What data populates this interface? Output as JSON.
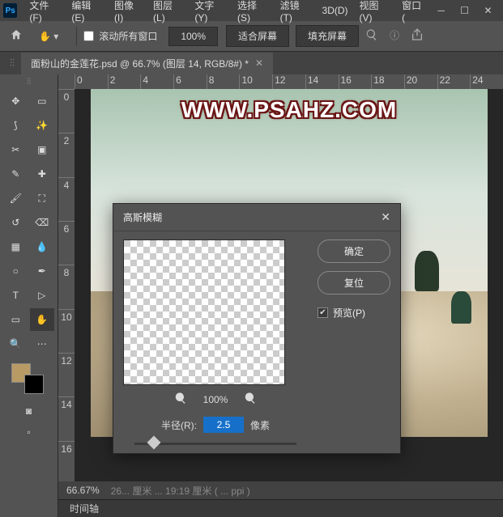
{
  "menu": {
    "file": "文件(F)",
    "edit": "编辑(E)",
    "image": "图像(I)",
    "layer": "图层(L)",
    "type": "文字(Y)",
    "select": "选择(S)",
    "filter": "滤镜(T)",
    "threeD": "3D(D)",
    "view": "视图(V)",
    "window": "窗口("
  },
  "options": {
    "scroll_all": "滚动所有窗口",
    "zoom": "100%",
    "fit_screen": "适合屏幕",
    "fill_screen": "填充屏幕"
  },
  "tab": {
    "title": "面粉山的金莲花.psd @ 66.7% (图层 14, RGB/8#) *"
  },
  "ruler_h": [
    "0",
    "2",
    "4",
    "6",
    "8",
    "10",
    "12",
    "14",
    "16",
    "18",
    "20",
    "22",
    "24"
  ],
  "ruler_v": [
    "0",
    "2",
    "4",
    "6",
    "8",
    "10",
    "12",
    "14",
    "16"
  ],
  "canvas": {
    "watermark": "WWW.PSAHZ.COM"
  },
  "status": {
    "zoom": "66.67%",
    "doc": "26... 厘米 ... 19:19 厘米 ( ... ppi )"
  },
  "panel": {
    "timeline": "时间轴"
  },
  "dialog": {
    "title": "高斯模糊",
    "ok": "确定",
    "reset": "复位",
    "preview": "预览(P)",
    "preview_zoom": "100%",
    "radius_label": "半径(R):",
    "radius_value": "2.5",
    "radius_unit": "像素"
  }
}
